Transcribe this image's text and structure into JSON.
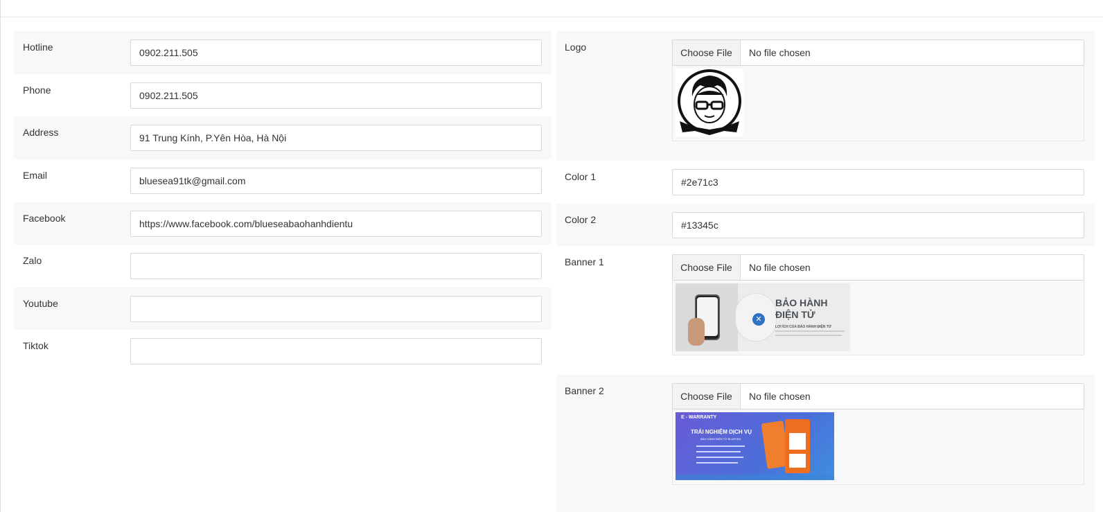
{
  "left_form": {
    "hotline": {
      "label": "Hotline",
      "value": "0902.211.505"
    },
    "phone": {
      "label": "Phone",
      "value": "0902.211.505"
    },
    "address": {
      "label": "Address",
      "value": "91 Trung Kính, P.Yên Hòa, Hà Nội"
    },
    "email": {
      "label": "Email",
      "value": "bluesea91tk@gmail.com"
    },
    "facebook": {
      "label": "Facebook",
      "value": "https://www.facebook.com/blueseabaohanhdientu"
    },
    "zalo": {
      "label": "Zalo",
      "value": ""
    },
    "youtube": {
      "label": "Youtube",
      "value": ""
    },
    "tiktok": {
      "label": "Tiktok",
      "value": ""
    }
  },
  "right_form": {
    "logo": {
      "label": "Logo",
      "button": "Choose File",
      "status": "No file chosen"
    },
    "color1": {
      "label": "Color 1",
      "value": "#2e71c3"
    },
    "color2": {
      "label": "Color 2",
      "value": "#13345c"
    },
    "banner1": {
      "label": "Banner 1",
      "button": "Choose File",
      "status": "No file chosen",
      "image_title_line1": "BẢO HÀNH",
      "image_title_line2": "ĐIỆN TỬ",
      "image_subtitle": "LỢI ÍCH CỦA BẢO HÀNH ĐIỆN TỬ"
    },
    "banner2": {
      "label": "Banner 2",
      "button": "Choose File",
      "status": "No file chosen",
      "image_brand": "E - WARRANTY",
      "image_headline": "TRẢI NGHIỆM DỊCH VỤ",
      "image_subheadline": "BẢO HÀNH ĐIỆN TỬ BLUESEA"
    }
  },
  "colors": {
    "row_shade": "#f7f8f9",
    "border": "#d8d8d8",
    "banner2_bg": "#5a5fd0"
  }
}
